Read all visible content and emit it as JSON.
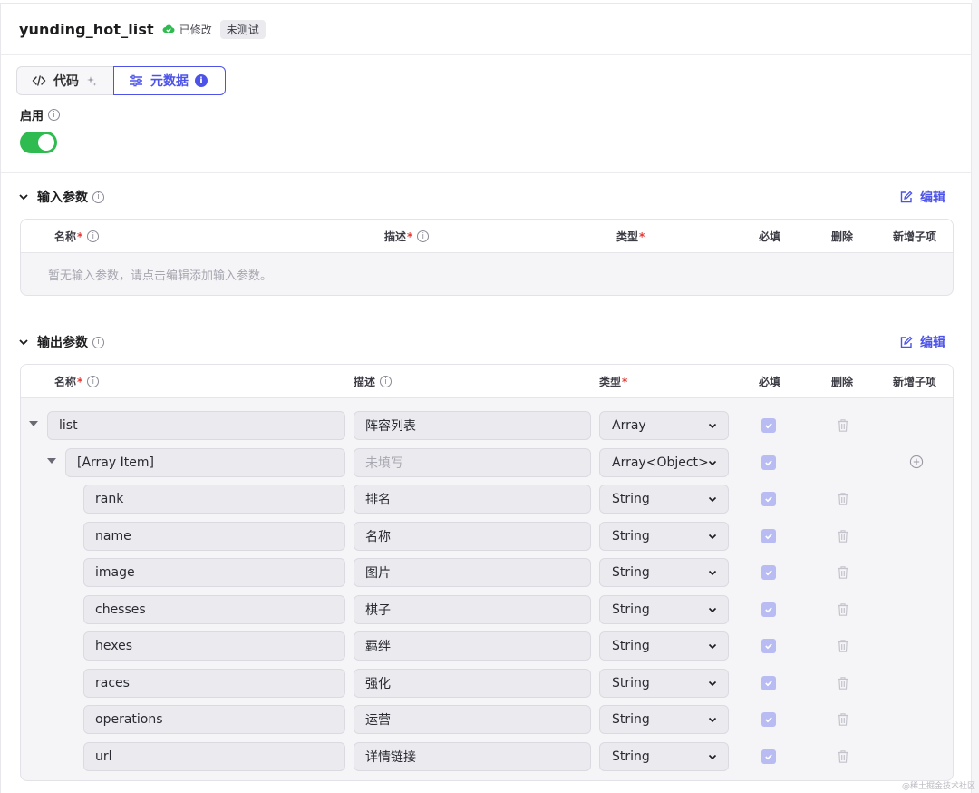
{
  "header": {
    "title": "yunding_hot_list",
    "modified_label": "已修改",
    "badge": "未测试"
  },
  "tabs": [
    {
      "label": "代码",
      "active": false
    },
    {
      "label": "元数据",
      "active": true,
      "info": "i"
    }
  ],
  "enable": {
    "label": "启用",
    "on": true
  },
  "input_section": {
    "title": "输入参数",
    "edit_label": "编辑",
    "columns": {
      "name": "名称",
      "desc": "描述",
      "type": "类型",
      "required": "必填",
      "delete": "删除",
      "add_child": "新增子项"
    },
    "required_mark": "*",
    "empty_text": "暂无输入参数，请点击编辑添加输入参数。"
  },
  "output_section": {
    "title": "输出参数",
    "edit_label": "编辑",
    "columns": {
      "name": "名称",
      "desc": "描述",
      "type": "类型",
      "required": "必填",
      "delete": "删除",
      "add_child": "新增子项"
    },
    "required_mark": "*",
    "rows": [
      {
        "name": "list",
        "desc": "阵容列表",
        "type": "Array",
        "required": true,
        "level": 0
      },
      {
        "name": "[Array Item]",
        "desc": "未填写",
        "type": "Array<Object>",
        "required": true,
        "level": 1,
        "desc_placeholder": true
      },
      {
        "name": "rank",
        "desc": "排名",
        "type": "String",
        "required": true,
        "level": 2
      },
      {
        "name": "name",
        "desc": "名称",
        "type": "String",
        "required": true,
        "level": 2
      },
      {
        "name": "image",
        "desc": "图片",
        "type": "String",
        "required": true,
        "level": 2
      },
      {
        "name": "chesses",
        "desc": "棋子",
        "type": "String",
        "required": true,
        "level": 2
      },
      {
        "name": "hexes",
        "desc": "羁绊",
        "type": "String",
        "required": true,
        "level": 2
      },
      {
        "name": "races",
        "desc": "强化",
        "type": "String",
        "required": true,
        "level": 2
      },
      {
        "name": "operations",
        "desc": "运营",
        "type": "String",
        "required": true,
        "level": 2
      },
      {
        "name": "url",
        "desc": "详情链接",
        "type": "String",
        "required": true,
        "level": 2
      }
    ]
  },
  "watermark": "@稀土掘金技术社区",
  "colors": {
    "accent": "#4d53e8",
    "toggle_on": "#2fbb4f",
    "required": "#e53935"
  }
}
